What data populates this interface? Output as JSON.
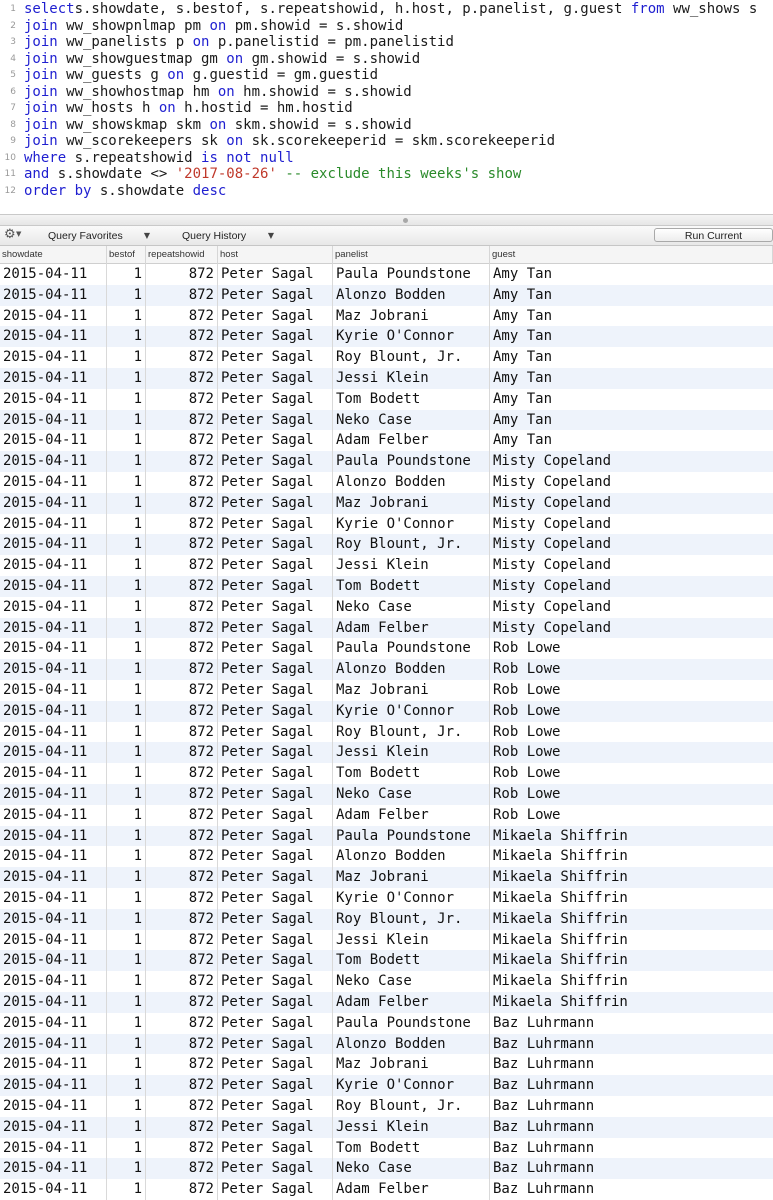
{
  "editor": {
    "lines": [
      {
        "num": "1",
        "tokens": [
          [
            "kw",
            "select"
          ],
          [
            "",
            "s.showdate, s.bestof, s.repeatshowid, h.host, p.panelist, g.guest "
          ],
          [
            "kw",
            "from"
          ],
          [
            "",
            " ww_shows s"
          ]
        ]
      },
      {
        "num": "2",
        "tokens": [
          [
            "kw",
            "join"
          ],
          [
            "",
            " ww_showpnlmap pm "
          ],
          [
            "kw",
            "on"
          ],
          [
            "",
            " pm.showid = s.showid"
          ]
        ]
      },
      {
        "num": "3",
        "tokens": [
          [
            "kw",
            "join"
          ],
          [
            "",
            " ww_panelists p "
          ],
          [
            "kw",
            "on"
          ],
          [
            "",
            " p.panelistid = pm.panelistid"
          ]
        ]
      },
      {
        "num": "4",
        "tokens": [
          [
            "kw",
            "join"
          ],
          [
            "",
            " ww_showguestmap gm "
          ],
          [
            "kw",
            "on"
          ],
          [
            "",
            " gm.showid = s.showid"
          ]
        ]
      },
      {
        "num": "5",
        "tokens": [
          [
            "kw",
            "join"
          ],
          [
            "",
            " ww_guests g "
          ],
          [
            "kw",
            "on"
          ],
          [
            "",
            " g.guestid = gm.guestid"
          ]
        ]
      },
      {
        "num": "6",
        "tokens": [
          [
            "kw",
            "join"
          ],
          [
            "",
            " ww_showhostmap hm "
          ],
          [
            "kw",
            "on"
          ],
          [
            "",
            " hm.showid = s.showid"
          ]
        ]
      },
      {
        "num": "7",
        "tokens": [
          [
            "kw",
            "join"
          ],
          [
            "",
            " ww_hosts h "
          ],
          [
            "kw",
            "on"
          ],
          [
            "",
            " h.hostid = hm.hostid"
          ]
        ]
      },
      {
        "num": "8",
        "tokens": [
          [
            "kw",
            "join"
          ],
          [
            "",
            " ww_showskmap skm "
          ],
          [
            "kw",
            "on"
          ],
          [
            "",
            " skm.showid = s.showid"
          ]
        ]
      },
      {
        "num": "9",
        "tokens": [
          [
            "kw",
            "join"
          ],
          [
            "",
            " ww_scorekeepers sk "
          ],
          [
            "kw",
            "on"
          ],
          [
            "",
            " sk.scorekeeperid = skm.scorekeeperid"
          ]
        ]
      },
      {
        "num": "10",
        "tokens": [
          [
            "kw",
            "where"
          ],
          [
            "",
            " s.repeatshowid "
          ],
          [
            "kw",
            "is not null"
          ]
        ]
      },
      {
        "num": "11",
        "tokens": [
          [
            "kw",
            "and"
          ],
          [
            "",
            " s.showdate <> "
          ],
          [
            "str",
            "'2017-08-26'"
          ],
          [
            "",
            " "
          ],
          [
            "cmt",
            "-- exclude this weeks's show"
          ]
        ]
      },
      {
        "num": "12",
        "tokens": [
          [
            "kw",
            "order by"
          ],
          [
            "",
            " s.showdate "
          ],
          [
            "kw",
            "desc"
          ]
        ]
      }
    ]
  },
  "toolbar": {
    "gear_icon": "gear-icon",
    "query_favorites": "Query Favorites",
    "query_history": "Query History",
    "run_current": "Run Current"
  },
  "grid": {
    "columns": [
      "showdate",
      "bestof",
      "repeatshowid",
      "host",
      "panelist",
      "guest"
    ],
    "rows": [
      [
        "2015-04-11",
        "1",
        "872",
        "Peter Sagal",
        "Paula Poundstone",
        "Amy Tan"
      ],
      [
        "2015-04-11",
        "1",
        "872",
        "Peter Sagal",
        "Alonzo Bodden",
        "Amy Tan"
      ],
      [
        "2015-04-11",
        "1",
        "872",
        "Peter Sagal",
        "Maz Jobrani",
        "Amy Tan"
      ],
      [
        "2015-04-11",
        "1",
        "872",
        "Peter Sagal",
        "Kyrie O'Connor",
        "Amy Tan"
      ],
      [
        "2015-04-11",
        "1",
        "872",
        "Peter Sagal",
        "Roy Blount, Jr.",
        "Amy Tan"
      ],
      [
        "2015-04-11",
        "1",
        "872",
        "Peter Sagal",
        "Jessi Klein",
        "Amy Tan"
      ],
      [
        "2015-04-11",
        "1",
        "872",
        "Peter Sagal",
        "Tom Bodett",
        "Amy Tan"
      ],
      [
        "2015-04-11",
        "1",
        "872",
        "Peter Sagal",
        "Neko Case",
        "Amy Tan"
      ],
      [
        "2015-04-11",
        "1",
        "872",
        "Peter Sagal",
        "Adam Felber",
        "Amy Tan"
      ],
      [
        "2015-04-11",
        "1",
        "872",
        "Peter Sagal",
        "Paula Poundstone",
        "Misty Copeland"
      ],
      [
        "2015-04-11",
        "1",
        "872",
        "Peter Sagal",
        "Alonzo Bodden",
        "Misty Copeland"
      ],
      [
        "2015-04-11",
        "1",
        "872",
        "Peter Sagal",
        "Maz Jobrani",
        "Misty Copeland"
      ],
      [
        "2015-04-11",
        "1",
        "872",
        "Peter Sagal",
        "Kyrie O'Connor",
        "Misty Copeland"
      ],
      [
        "2015-04-11",
        "1",
        "872",
        "Peter Sagal",
        "Roy Blount, Jr.",
        "Misty Copeland"
      ],
      [
        "2015-04-11",
        "1",
        "872",
        "Peter Sagal",
        "Jessi Klein",
        "Misty Copeland"
      ],
      [
        "2015-04-11",
        "1",
        "872",
        "Peter Sagal",
        "Tom Bodett",
        "Misty Copeland"
      ],
      [
        "2015-04-11",
        "1",
        "872",
        "Peter Sagal",
        "Neko Case",
        "Misty Copeland"
      ],
      [
        "2015-04-11",
        "1",
        "872",
        "Peter Sagal",
        "Adam Felber",
        "Misty Copeland"
      ],
      [
        "2015-04-11",
        "1",
        "872",
        "Peter Sagal",
        "Paula Poundstone",
        "Rob Lowe"
      ],
      [
        "2015-04-11",
        "1",
        "872",
        "Peter Sagal",
        "Alonzo Bodden",
        "Rob Lowe"
      ],
      [
        "2015-04-11",
        "1",
        "872",
        "Peter Sagal",
        "Maz Jobrani",
        "Rob Lowe"
      ],
      [
        "2015-04-11",
        "1",
        "872",
        "Peter Sagal",
        "Kyrie O'Connor",
        "Rob Lowe"
      ],
      [
        "2015-04-11",
        "1",
        "872",
        "Peter Sagal",
        "Roy Blount, Jr.",
        "Rob Lowe"
      ],
      [
        "2015-04-11",
        "1",
        "872",
        "Peter Sagal",
        "Jessi Klein",
        "Rob Lowe"
      ],
      [
        "2015-04-11",
        "1",
        "872",
        "Peter Sagal",
        "Tom Bodett",
        "Rob Lowe"
      ],
      [
        "2015-04-11",
        "1",
        "872",
        "Peter Sagal",
        "Neko Case",
        "Rob Lowe"
      ],
      [
        "2015-04-11",
        "1",
        "872",
        "Peter Sagal",
        "Adam Felber",
        "Rob Lowe"
      ],
      [
        "2015-04-11",
        "1",
        "872",
        "Peter Sagal",
        "Paula Poundstone",
        "Mikaela Shiffrin"
      ],
      [
        "2015-04-11",
        "1",
        "872",
        "Peter Sagal",
        "Alonzo Bodden",
        "Mikaela Shiffrin"
      ],
      [
        "2015-04-11",
        "1",
        "872",
        "Peter Sagal",
        "Maz Jobrani",
        "Mikaela Shiffrin"
      ],
      [
        "2015-04-11",
        "1",
        "872",
        "Peter Sagal",
        "Kyrie O'Connor",
        "Mikaela Shiffrin"
      ],
      [
        "2015-04-11",
        "1",
        "872",
        "Peter Sagal",
        "Roy Blount, Jr.",
        "Mikaela Shiffrin"
      ],
      [
        "2015-04-11",
        "1",
        "872",
        "Peter Sagal",
        "Jessi Klein",
        "Mikaela Shiffrin"
      ],
      [
        "2015-04-11",
        "1",
        "872",
        "Peter Sagal",
        "Tom Bodett",
        "Mikaela Shiffrin"
      ],
      [
        "2015-04-11",
        "1",
        "872",
        "Peter Sagal",
        "Neko Case",
        "Mikaela Shiffrin"
      ],
      [
        "2015-04-11",
        "1",
        "872",
        "Peter Sagal",
        "Adam Felber",
        "Mikaela Shiffrin"
      ],
      [
        "2015-04-11",
        "1",
        "872",
        "Peter Sagal",
        "Paula Poundstone",
        "Baz Luhrmann"
      ],
      [
        "2015-04-11",
        "1",
        "872",
        "Peter Sagal",
        "Alonzo Bodden",
        "Baz Luhrmann"
      ],
      [
        "2015-04-11",
        "1",
        "872",
        "Peter Sagal",
        "Maz Jobrani",
        "Baz Luhrmann"
      ],
      [
        "2015-04-11",
        "1",
        "872",
        "Peter Sagal",
        "Kyrie O'Connor",
        "Baz Luhrmann"
      ],
      [
        "2015-04-11",
        "1",
        "872",
        "Peter Sagal",
        "Roy Blount, Jr.",
        "Baz Luhrmann"
      ],
      [
        "2015-04-11",
        "1",
        "872",
        "Peter Sagal",
        "Jessi Klein",
        "Baz Luhrmann"
      ],
      [
        "2015-04-11",
        "1",
        "872",
        "Peter Sagal",
        "Tom Bodett",
        "Baz Luhrmann"
      ],
      [
        "2015-04-11",
        "1",
        "872",
        "Peter Sagal",
        "Neko Case",
        "Baz Luhrmann"
      ],
      [
        "2015-04-11",
        "1",
        "872",
        "Peter Sagal",
        "Adam Felber",
        "Baz Luhrmann"
      ]
    ]
  },
  "colors": {
    "keyword": "#1f1fd0",
    "string": "#c0392b",
    "comment": "#2a8a2a",
    "alt_row": "#eef3fb"
  }
}
